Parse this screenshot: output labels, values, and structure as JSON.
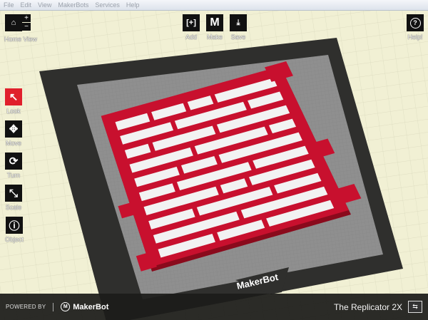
{
  "menu": [
    "File",
    "Edit",
    "View",
    "MakerBots",
    "Services",
    "Help"
  ],
  "toolbar": {
    "home_view": "Home View",
    "zoom_in": "+",
    "zoom_out": "−",
    "add": "Add",
    "add_glyph": "[+]",
    "make": "Make",
    "make_glyph": "M",
    "save": "Save",
    "help": "Help!",
    "help_glyph": "?"
  },
  "tools": [
    {
      "label": "Look",
      "glyph": "↖",
      "active": true
    },
    {
      "label": "Move",
      "glyph": "✥"
    },
    {
      "label": "Turn",
      "glyph": "⟳"
    },
    {
      "label": "Scale",
      "glyph": "⤡"
    },
    {
      "label": "Object",
      "glyph": "ⓘ"
    }
  ],
  "platform_label": "MakerBot",
  "footer": {
    "powered_by": "POWERED BY",
    "brand": "MakerBot",
    "brand_glyph": "M",
    "printer": "The Replicator 2X"
  },
  "colors": {
    "accent": "#e0202c",
    "object": "#c8102e",
    "platform": "#8f8f8f",
    "border": "#2e2e2e"
  }
}
